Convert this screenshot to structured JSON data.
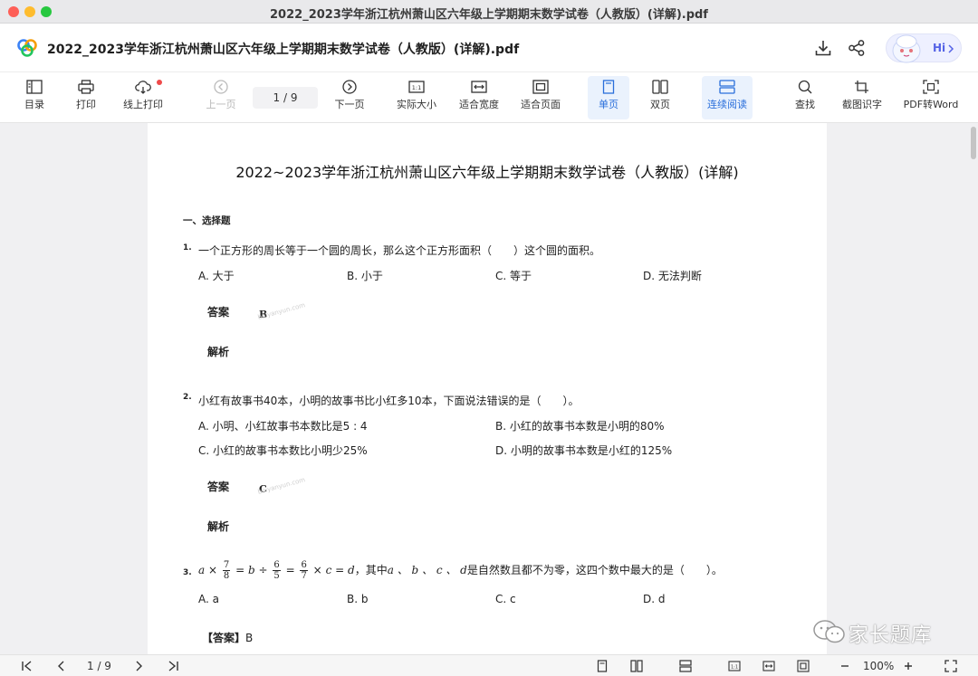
{
  "window": {
    "title": "2022_2023学年浙江杭州萧山区六年级上学期期末数学试卷（人教版）(详解).pdf"
  },
  "header": {
    "doc_title": "2022_2023学年浙江杭州萧山区六年级上学期期末数学试卷（人教版）(详解).pdf",
    "assistant_label": "Hi",
    "icons": [
      "download-icon",
      "share-icon"
    ]
  },
  "toolbar": {
    "toc": "目录",
    "print": "打印",
    "online_print": "线上打印",
    "prev_page": "上一页",
    "page_indicator": "1 / 9",
    "next_page": "下一页",
    "actual_size": "实际大小",
    "fit_width": "适合宽度",
    "fit_page": "适合页面",
    "single_page": "单页",
    "double_page": "双页",
    "continuous": "连续阅读",
    "search": "查找",
    "ocr": "截图识字",
    "pdf_to_word": "PDF转Word"
  },
  "document": {
    "title": "2022~2023学年浙江杭州萧山区六年级上学期期末数学试卷（人教版）(详解)",
    "section": "一、选择题",
    "answer_label": "答案",
    "analysis_label": "解析",
    "watermark": "baiyanyun.com",
    "questions": [
      {
        "num": "1.",
        "text": "一个正方形的周长等于一个圆的周长，那么这个正方形面积（　　）这个圆的面积。",
        "options": [
          "A. 大于",
          "B. 小于",
          "C. 等于",
          "D. 无法判断"
        ],
        "answer": "B"
      },
      {
        "num": "2.",
        "text": "小红有故事书40本，小明的故事书比小红多10本，下面说法错误的是（　　）。",
        "options": [
          "A. 小明、小红故事书本数比是5 : 4",
          "B. 小红的故事书本数是小明的80%",
          "C. 小红的故事书本数比小明少25%",
          "D. 小明的故事书本数是小红的125%"
        ],
        "answer": "C"
      },
      {
        "num": "3.",
        "math": {
          "a": "a",
          "times": "×",
          "f1_num": "7",
          "f1_den": "8",
          "eq": "=",
          "b": "b",
          "div": "÷",
          "f2_num": "6",
          "f2_den": "5",
          "f3_num": "6",
          "f3_den": "7",
          "c": "c",
          "d": "d"
        },
        "text_tail_1": "，其中",
        "vars_list": "a 、 b 、 c 、 d",
        "text_tail_2": "是自然数且都不为零，这四个数中最大的是（　　）。",
        "options": [
          "A. a",
          "B. b",
          "C. c",
          "D. d"
        ],
        "answer_bracket": "【答案】",
        "answer": "B"
      }
    ]
  },
  "brand_watermark": "家长题库",
  "statusbar": {
    "page_indicator": "1 / 9",
    "zoom": "100%"
  },
  "colors": {
    "accent": "#2a6fdb",
    "active_bg": "#eaf2fd",
    "notification_dot": "#ef4a4a"
  }
}
